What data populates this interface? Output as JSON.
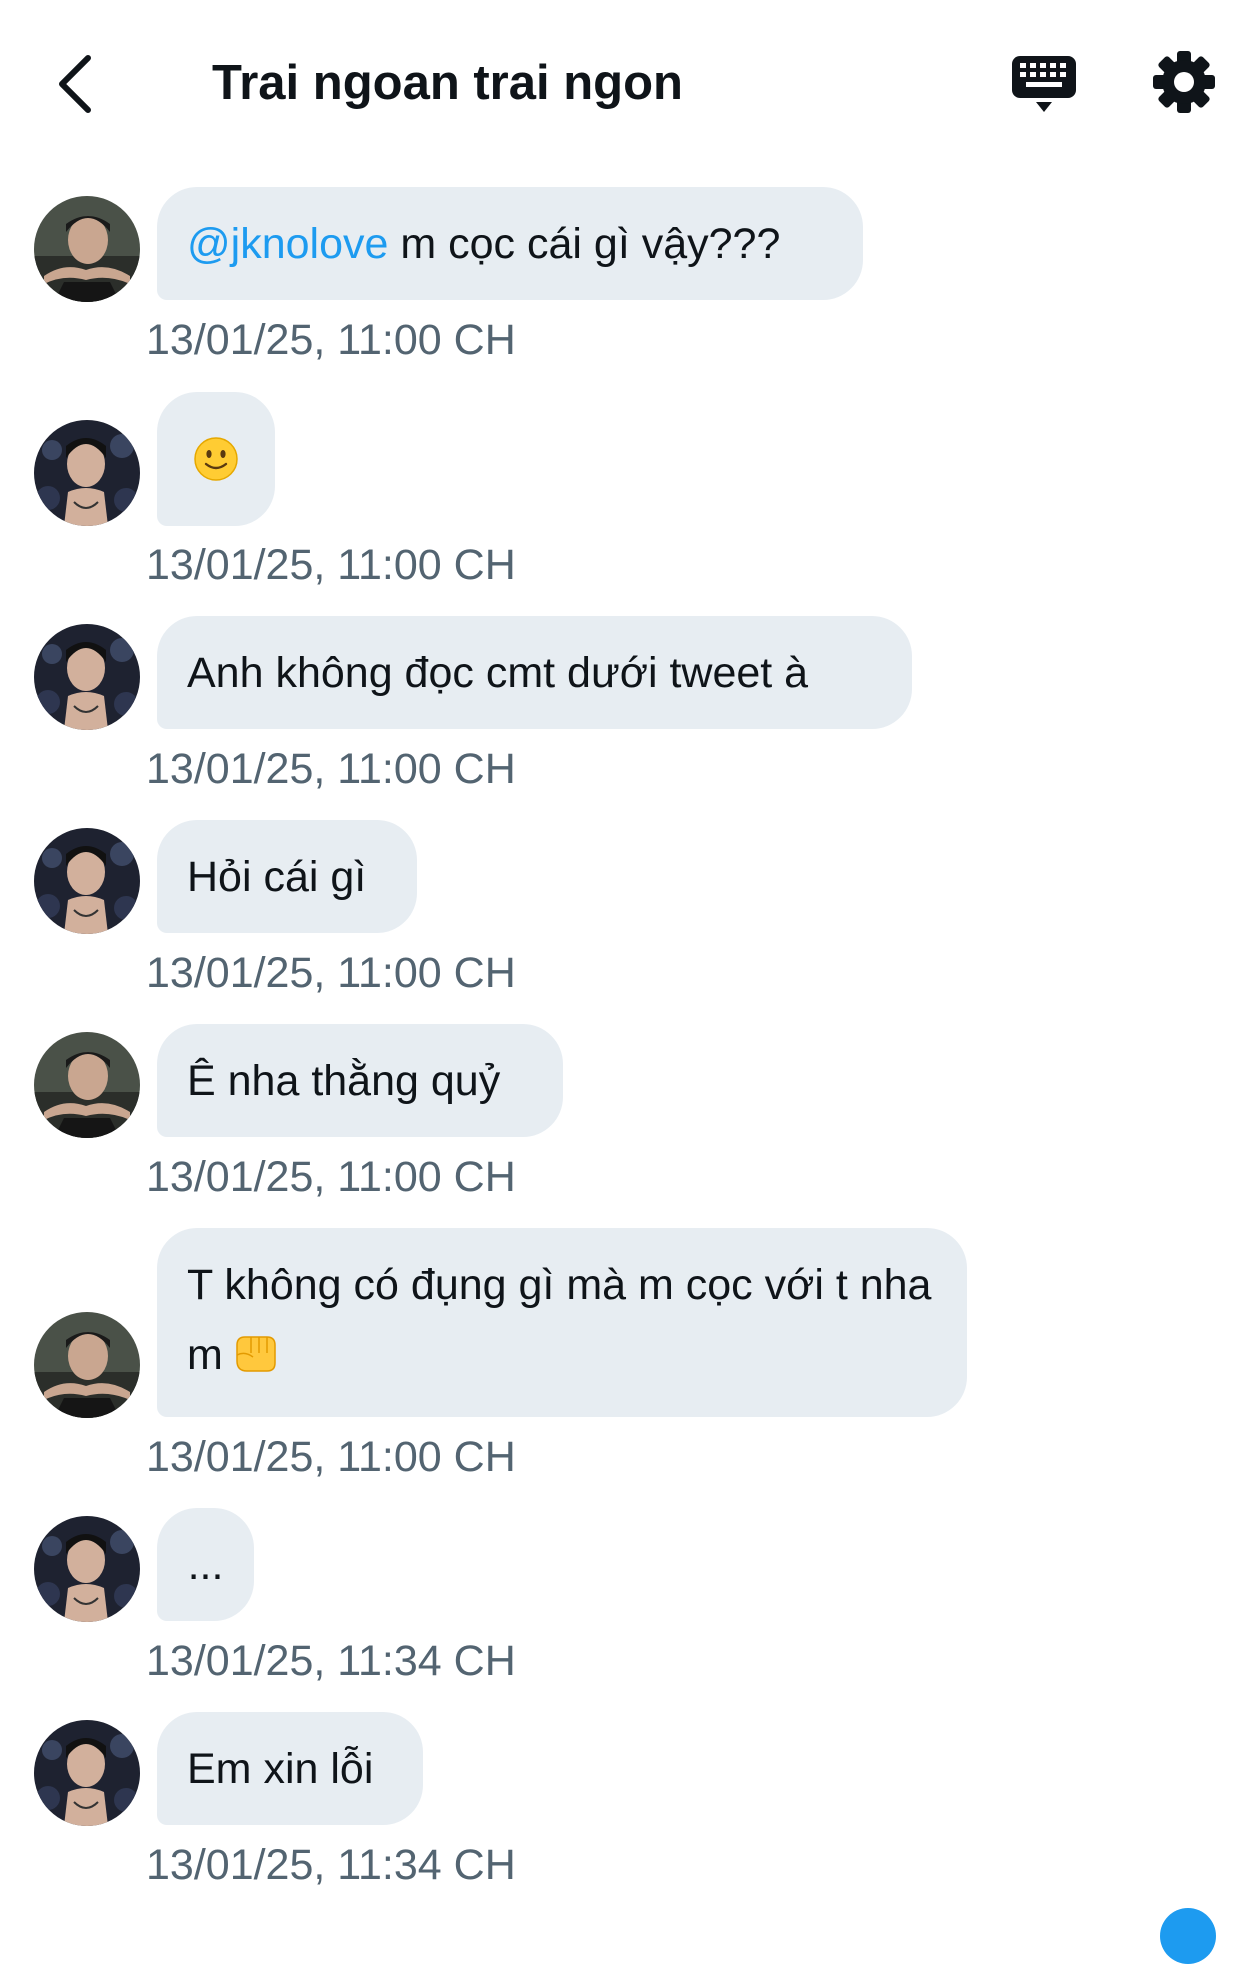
{
  "header": {
    "title": "Trai ngoan trai ngon",
    "back_icon": "chevron-left-icon",
    "keyboard_icon": "keyboard-icon",
    "settings_icon": "gear-icon"
  },
  "messages": [
    {
      "mention": "@jknolove",
      "text": " m cọc cái gì vậy???",
      "timestamp": "13/01/25, 11:00 CH",
      "avatar": "avatar-a"
    },
    {
      "emoji": "slightly-smiling-face",
      "timestamp": "13/01/25, 11:00 CH",
      "avatar": "avatar-b"
    },
    {
      "text": "Anh không đọc cmt dưới tweet à",
      "timestamp": "13/01/25, 11:00 CH",
      "avatar": "avatar-b"
    },
    {
      "text": "Hỏi cái gì",
      "timestamp": "13/01/25, 11:00 CH",
      "avatar": "avatar-b"
    },
    {
      "text": "Ê nha thằng quỷ",
      "timestamp": "13/01/25, 11:00 CH",
      "avatar": "avatar-a"
    },
    {
      "text": "T không có đụng gì mà m cọc với t nha m",
      "emoji": "left-facing-fist",
      "timestamp": "13/01/25, 11:00 CH",
      "avatar": "avatar-a"
    },
    {
      "text": "...",
      "timestamp": "13/01/25, 11:34 CH",
      "avatar": "avatar-b"
    },
    {
      "text": "Em xin lỗi",
      "timestamp": "13/01/25, 11:34 CH",
      "avatar": "avatar-b"
    }
  ],
  "colors": {
    "bubble": "#e7edf2",
    "mention": "#1d9bf0",
    "timestamp": "#536471",
    "text": "#0f1419"
  }
}
